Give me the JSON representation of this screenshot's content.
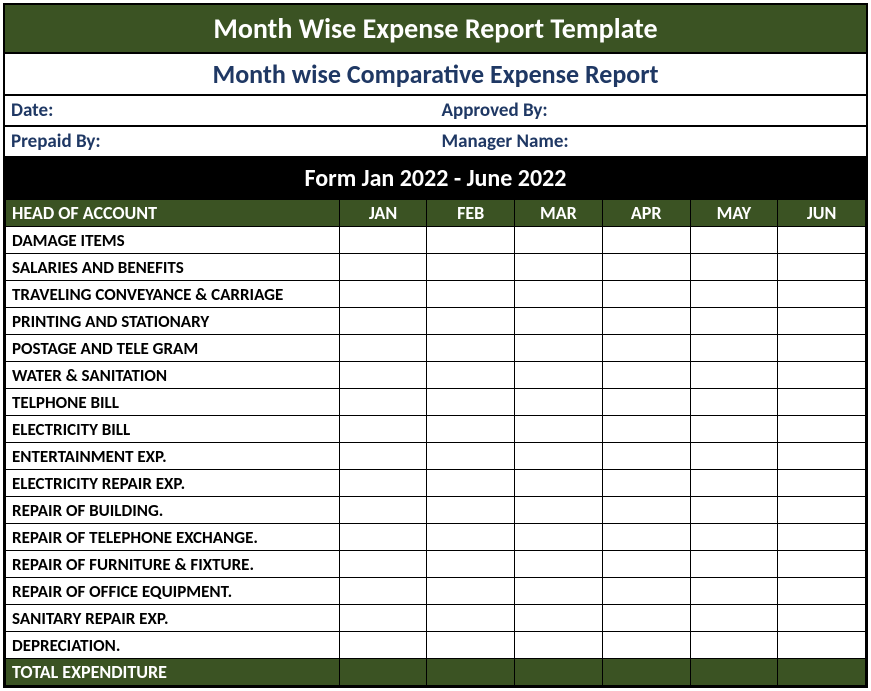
{
  "titles": {
    "main": "Month Wise Expense Report Template",
    "sub": "Month wise Comparative Expense Report",
    "period": "Form Jan 2022 - June 2022"
  },
  "info": {
    "date_label": "Date:",
    "approved_label": "Approved By:",
    "prepaid_label": "Prepaid By:",
    "manager_label": "Manager Name:"
  },
  "table": {
    "head_account": "HEAD OF ACCOUNT",
    "months": [
      "JAN",
      "FEB",
      "MAR",
      "APR",
      "MAY",
      "JUN"
    ],
    "rows": [
      "DAMAGE ITEMS",
      "SALARIES AND BENEFITS",
      "TRAVELING CONVEYANCE & CARRIAGE",
      "PRINTING AND STATIONARY",
      "POSTAGE AND TELE GRAM",
      "WATER & SANITATION",
      "TELPHONE BILL",
      "ELECTRICITY BILL",
      "ENTERTAINMENT EXP.",
      "ELECTRICITY REPAIR EXP.",
      "REPAIR OF BUILDING.",
      "REPAIR OF TELEPHONE EXCHANGE.",
      "REPAIR OF FURNITURE & FIXTURE.",
      "REPAIR OF OFFICE EQUIPMENT.",
      "SANITARY REPAIR EXP.",
      "DEPRECIATION."
    ],
    "total_label": "TOTAL EXPENDITURE"
  }
}
